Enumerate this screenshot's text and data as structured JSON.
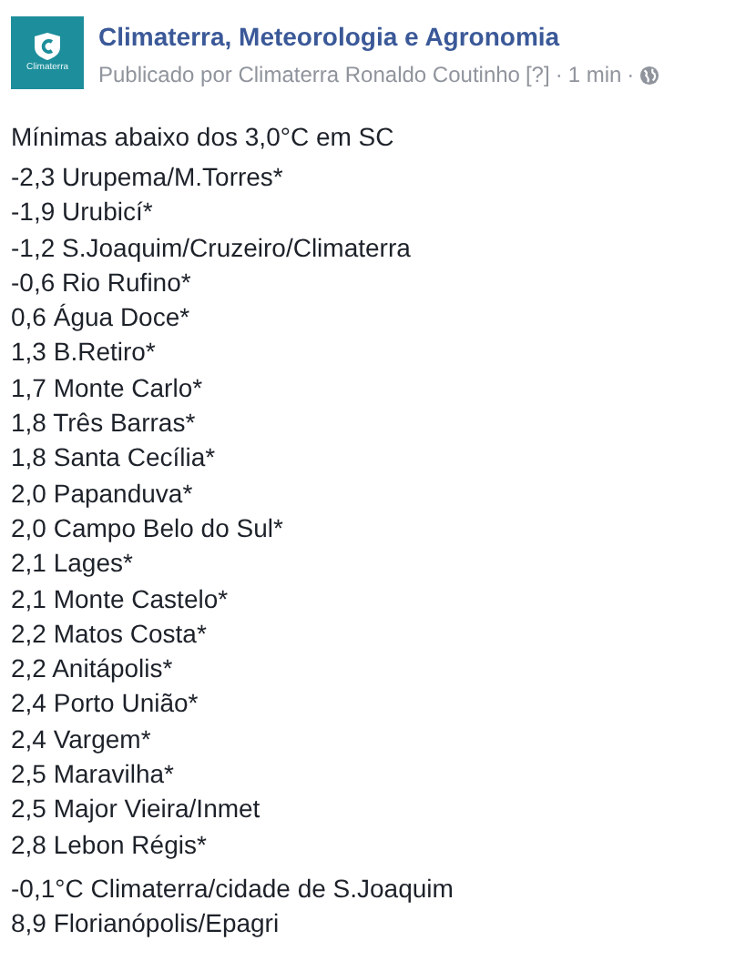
{
  "post": {
    "page_name": "Climaterra, Meteorologia e Agronomia",
    "avatar_label": "Climaterra",
    "byline": "Publicado por Climaterra Ronaldo Coutinho",
    "byline_help": "[?]",
    "time": "1 min",
    "separator": "·"
  },
  "heading": "Mínimas abaixo dos 3,0°C em SC",
  "groups": [
    [
      "-2,3 Urupema/M.Torres*",
      "-1,9 Urubicí*",
      "-1,2 S.Joaquim/Cruzeiro/Climaterra",
      "-0,6 Rio Rufino*",
      "0,6 Água Doce*",
      "1,3 B.Retiro*",
      "1,7 Monte Carlo*",
      "1,8 Três Barras*",
      "1,8 Santa Cecília*",
      "2,0 Papanduva*",
      "2,0 Campo Belo do Sul*",
      "2,1 Lages*",
      "2,1 Monte Castelo*",
      "2,2 Matos Costa*",
      "2,2 Anitápolis*",
      "2,4 Porto União*",
      "2,4 Vargem*",
      "2,5 Maravilha*",
      "2,5 Major Vieira/Inmet",
      "2,8 Lebon Régis*"
    ],
    [
      "-0,1°C Climaterra/cidade de S.Joaquim",
      "8,9 Florianópolis/Epagri"
    ]
  ]
}
